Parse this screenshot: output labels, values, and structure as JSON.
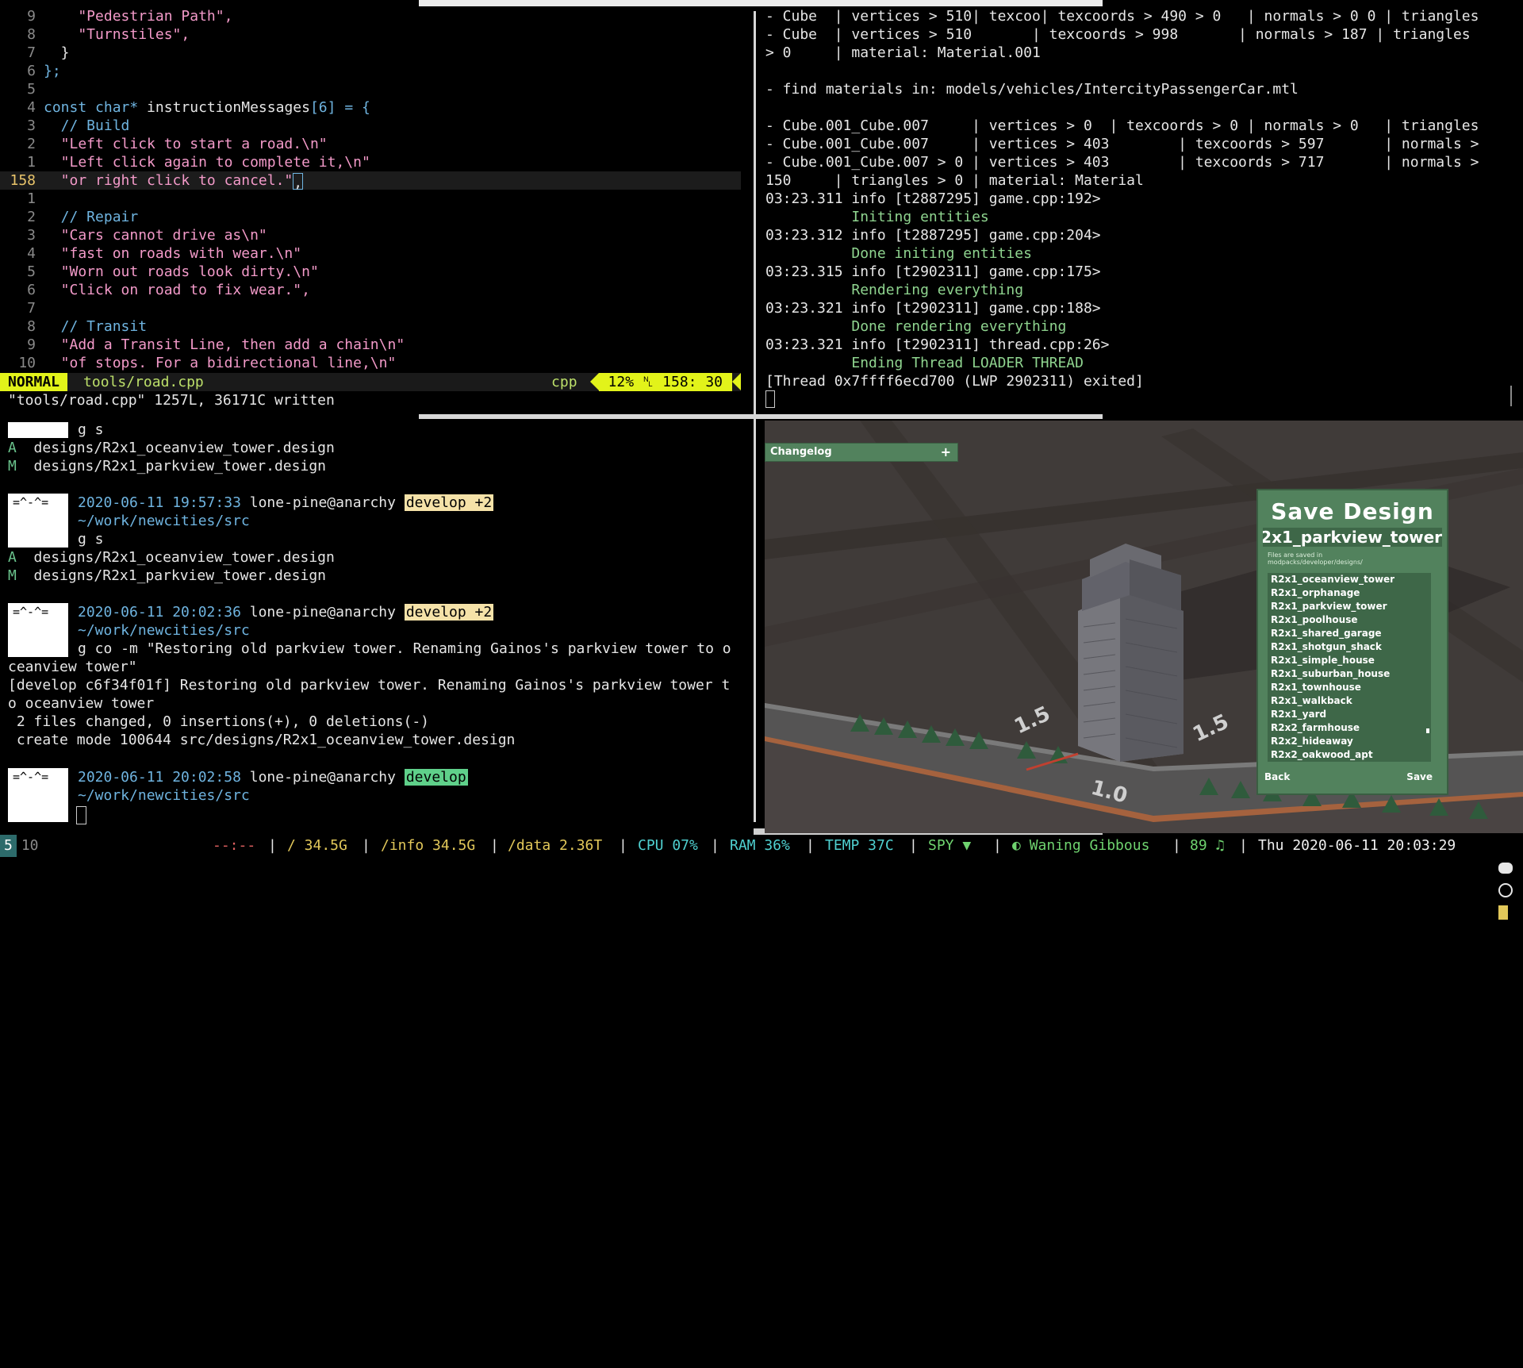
{
  "editor": {
    "lines": [
      {
        "num": "9",
        "text": "    \"Pedestrian Path\",",
        "kind": "str"
      },
      {
        "num": "8",
        "text": "    \"Turnstiles\",",
        "kind": "str"
      },
      {
        "num": "7",
        "text": "  }",
        "kind": "punc"
      },
      {
        "num": "6",
        "text": "};",
        "kind": "kw"
      },
      {
        "num": "5",
        "text": "",
        "kind": "punc"
      },
      {
        "num": "4",
        "text": "const char* instructionMessages[6] = {",
        "kind": "decl"
      },
      {
        "num": "3",
        "text": "  // Build",
        "kind": "cmt"
      },
      {
        "num": "2",
        "text": "  \"Left click to start a road.\\n\"",
        "kind": "str"
      },
      {
        "num": "1",
        "text": "  \"Left click again to complete it,\\n\"",
        "kind": "str"
      },
      {
        "num": "158",
        "text": "  \"or right click to cancel.\"",
        "kind": "cur",
        "cursor_char": ","
      },
      {
        "num": "1",
        "text": "",
        "kind": "punc"
      },
      {
        "num": "2",
        "text": "  // Repair",
        "kind": "cmt"
      },
      {
        "num": "3",
        "text": "  \"Cars cannot drive as\\n\"",
        "kind": "str"
      },
      {
        "num": "4",
        "text": "  \"fast on roads with wear.\\n\"",
        "kind": "str"
      },
      {
        "num": "5",
        "text": "  \"Worn out roads look dirty.\\n\"",
        "kind": "str"
      },
      {
        "num": "6",
        "text": "  \"Click on road to fix wear.\",",
        "kind": "str"
      },
      {
        "num": "7",
        "text": "",
        "kind": "punc"
      },
      {
        "num": "8",
        "text": "  // Transit",
        "kind": "cmt"
      },
      {
        "num": "9",
        "text": "  \"Add a Transit Line, then add a chain\\n\"",
        "kind": "str"
      },
      {
        "num": "10",
        "text": "  \"of stops. For a bidirectional line,\\n\"",
        "kind": "str"
      }
    ],
    "decl_parts": {
      "kw1": "const char*",
      "name": " instructionMessages",
      "bracket": "[6]",
      "rest": " = {"
    },
    "mode": "NORMAL",
    "file": "tools/road.cpp",
    "filetype": "cpp",
    "percent": "12%",
    "position": "158: 30",
    "message": "\"tools/road.cpp\" 1257L, 36171C written"
  },
  "log": {
    "lines": [
      {
        "text": "- Cube  | vertices > 510| texcoo| texcoords > 490 > 0   | normals > 0 0 | triangles",
        "kind": "plain"
      },
      {
        "text": "- Cube  | vertices > 510       | texcoords > 998       | normals > 187 | triangles",
        "kind": "plain"
      },
      {
        "text": "> 0     | material: Material.001",
        "kind": "plain"
      },
      {
        "text": "",
        "kind": "plain"
      },
      {
        "text": "- find materials in: models/vehicles/IntercityPassengerCar.mtl",
        "kind": "plain"
      },
      {
        "text": "",
        "kind": "plain"
      },
      {
        "text": "- Cube.001_Cube.007     | vertices > 0  | texcoords > 0 | normals > 0   | triangles",
        "kind": "plain"
      },
      {
        "text": "- Cube.001_Cube.007     | vertices > 403        | texcoords > 597       | normals >",
        "kind": "plain"
      },
      {
        "text": "- Cube.001_Cube.007 > 0 | vertices > 403        | texcoords > 717       | normals >",
        "kind": "plain"
      },
      {
        "text": "150     | triangles > 0 | material: Material",
        "kind": "plain"
      },
      {
        "text": "03:23.311 info [t2887295] game.cpp:192>",
        "kind": "plain"
      },
      {
        "text": "          Initing entities",
        "kind": "green"
      },
      {
        "text": "03:23.312 info [t2887295] game.cpp:204>",
        "kind": "plain"
      },
      {
        "text": "          Done initing entities",
        "kind": "green"
      },
      {
        "text": "03:23.315 info [t2902311] game.cpp:175>",
        "kind": "plain"
      },
      {
        "text": "          Rendering everything",
        "kind": "green"
      },
      {
        "text": "03:23.321 info [t2902311] game.cpp:188>",
        "kind": "plain"
      },
      {
        "text": "          Done rendering everything",
        "kind": "green"
      },
      {
        "text": "03:23.321 info [t2902311] thread.cpp:26>",
        "kind": "plain"
      },
      {
        "text": "          Ending Thread LOADER THREAD",
        "kind": "green"
      },
      {
        "text": "[Thread 0x7ffff6ecd700 (LWP 2902311) exited]",
        "kind": "plain"
      }
    ]
  },
  "terminal": {
    "first_cmd": "g s",
    "avatar_text": "=^-^=",
    "status1": [
      {
        "flag": "A",
        "path": "designs/R2x1_oceanview_tower.design"
      },
      {
        "flag": "M",
        "path": "designs/R2x1_parkview_tower.design"
      }
    ],
    "prompt1": {
      "time": "2020-06-11 19:57:33",
      "user": "lone-pine@anarchy",
      "branch": "develop +2",
      "cwd": "~/work/newcities/src",
      "cmd": "g s"
    },
    "status2": [
      {
        "flag": "A",
        "path": "designs/R2x1_oceanview_tower.design"
      },
      {
        "flag": "M",
        "path": "designs/R2x1_parkview_tower.design"
      }
    ],
    "prompt2": {
      "time": "2020-06-11 20:02:36",
      "user": "lone-pine@anarchy",
      "branch": "develop +2",
      "cwd": "~/work/newcities/src",
      "cmd1": "g co -m \"Restoring old parkview tower. Renaming Gainos's parkview tower to o",
      "cmd2": "ceanview tower\""
    },
    "output": [
      "[develop c6f34f01f] Restoring old parkview tower. Renaming Gainos's parkview tower t",
      "o oceanview tower",
      " 2 files changed, 0 insertions(+), 0 deletions(-)",
      " create mode 100644 src/designs/R2x1_oceanview_tower.design"
    ],
    "prompt3": {
      "time": "2020-06-11 20:02:58",
      "user": "lone-pine@anarchy",
      "branch": "develop",
      "cwd": "~/work/newcities/src"
    }
  },
  "game": {
    "changelog_label": "Changelog",
    "changelog_plus": "+",
    "dialog_title": "Save Design",
    "name_value": "R2x1_parkview_tower",
    "hint_line1": "Files are saved in",
    "hint_line2": "modpacks/developer/designs/",
    "files": [
      "R2x1_oceanview_tower",
      "R2x1_orphanage",
      "R2x1_parkview_tower",
      "R2x1_poolhouse",
      "R2x1_shared_garage",
      "R2x1_shotgun_shack",
      "R2x1_simple_house",
      "R2x1_suburban_house",
      "R2x1_townhouse",
      "R2x1_walkback",
      "R2x1_yard",
      "R2x2_farmhouse",
      "R2x2_hideaway",
      "R2x2_oakwood_apt"
    ],
    "back_label": "Back",
    "save_label": "Save",
    "ground_labels": [
      "1.5",
      "1.5",
      "1.0"
    ]
  },
  "bar": {
    "workspace_active": "5",
    "workspace_other": "10",
    "net": "--:--",
    "disk_root": "/ 34.5G",
    "disk_info": "/info 34.5G",
    "disk_data": "/data 2.36T",
    "cpu": "CPU 07%",
    "ram": "RAM 36%",
    "temp": "TEMP 37C",
    "spy": "SPY ▼",
    "moon": "Waning Gibbous",
    "volume": "89 ♫",
    "datetime": "Thu 2020-06-11 20:03:29",
    "colors": {
      "cyan": "#4fd0d0",
      "red": "#e06060",
      "yellow": "#e2c85a",
      "green": "#6fd36f"
    }
  }
}
